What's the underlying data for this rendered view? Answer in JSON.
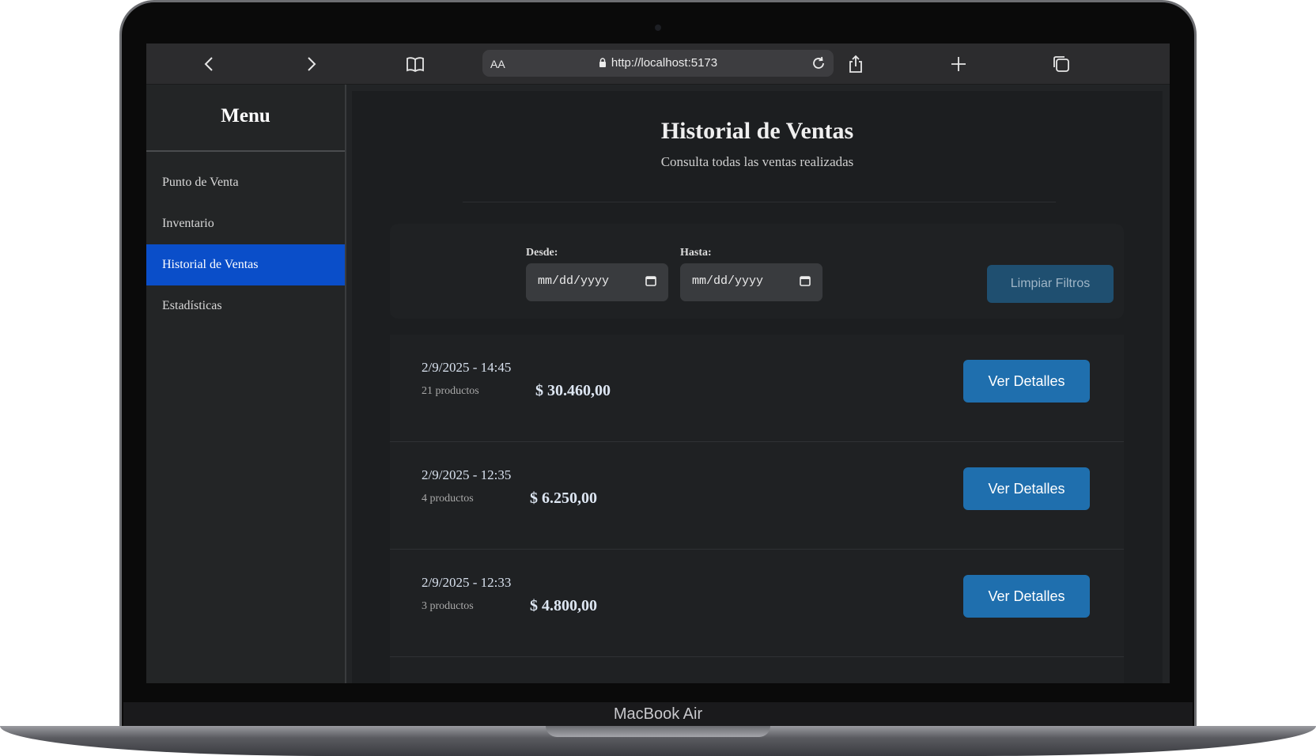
{
  "device": {
    "brand": "MacBook Air"
  },
  "browser": {
    "text_size_label": "AA",
    "url": "http://localhost:5173"
  },
  "sidebar": {
    "title": "Menu",
    "items": [
      {
        "label": "Punto de Venta",
        "active": false
      },
      {
        "label": "Inventario",
        "active": false
      },
      {
        "label": "Historial de Ventas",
        "active": true
      },
      {
        "label": "Estadísticas",
        "active": false
      }
    ]
  },
  "page": {
    "title": "Historial de Ventas",
    "subtitle": "Consulta todas las ventas realizadas"
  },
  "filters": {
    "from_label": "Desde:",
    "from_value": "mm/dd/yyyy",
    "to_label": "Hasta:",
    "to_value": "mm/dd/yyyy",
    "clear_label": "Limpiar Filtros"
  },
  "sales": [
    {
      "datetime": "2/9/2025 - 14:45",
      "products": "21 productos",
      "total": "$ 30.460,00",
      "action": "Ver Detalles"
    },
    {
      "datetime": "2/9/2025 - 12:35",
      "products": "4 productos",
      "total": "$ 6.250,00",
      "action": "Ver Detalles"
    },
    {
      "datetime": "2/9/2025 - 12:33",
      "products": "3 productos",
      "total": "$ 4.800,00",
      "action": "Ver Detalles"
    }
  ],
  "colors": {
    "active_nav": "#0a4ec9",
    "primary_button": "#1f6fae",
    "disabled_button": "#1f4f70"
  }
}
